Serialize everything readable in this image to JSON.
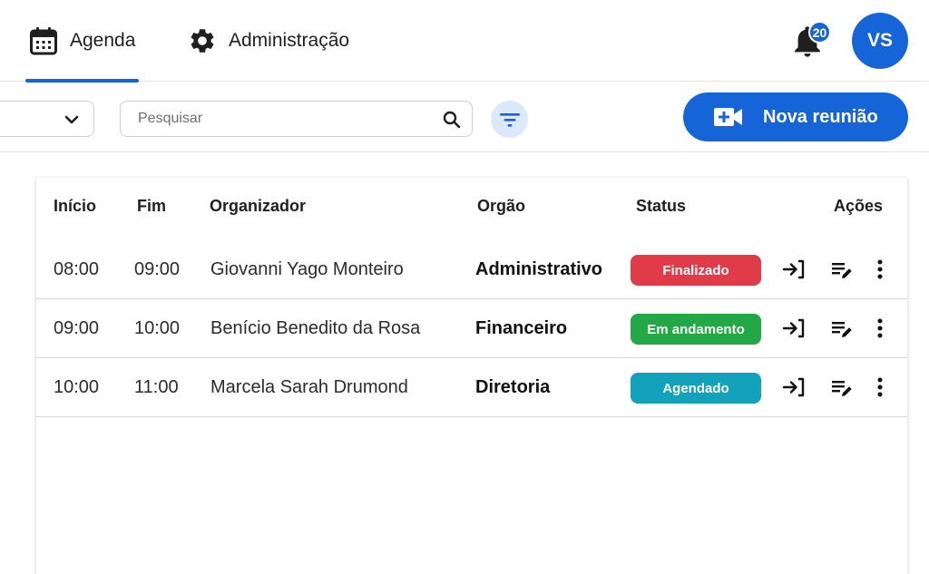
{
  "nav": {
    "tabs": [
      {
        "label": "Agenda",
        "icon": "calendar-icon",
        "active": true
      },
      {
        "label": "Administração",
        "icon": "gear-icon",
        "active": false
      }
    ],
    "notifications": {
      "count": "20",
      "icon": "bell-icon"
    },
    "user": {
      "initials": "VS"
    }
  },
  "toolbar": {
    "search": {
      "placeholder": "Pesquisar",
      "value": ""
    },
    "select": {
      "value": ""
    },
    "new_meeting_label": "Nova reunião"
  },
  "table": {
    "headers": {
      "start": "Início",
      "end": "Fim",
      "organizer": "Organizador",
      "department": "Orgão",
      "status": "Status",
      "actions": "Ações"
    },
    "rows": [
      {
        "start": "08:00",
        "end": "09:00",
        "organizer": "Giovanni Yago Monteiro",
        "department": "Administrativo",
        "status": "Finalizado",
        "status_color": "#df3b48"
      },
      {
        "start": "09:00",
        "end": "10:00",
        "organizer": "Benício Benedito da Rosa",
        "department": "Financeiro",
        "status": "Em andamento",
        "status_color": "#22a845"
      },
      {
        "start": "10:00",
        "end": "11:00",
        "organizer": "Marcela Sarah Drumond",
        "department": "Diretoria",
        "status": "Agendado",
        "status_color": "#12a2bc"
      }
    ]
  },
  "colors": {
    "primary": "#1565d8",
    "filter_bg": "#dce8fb"
  }
}
